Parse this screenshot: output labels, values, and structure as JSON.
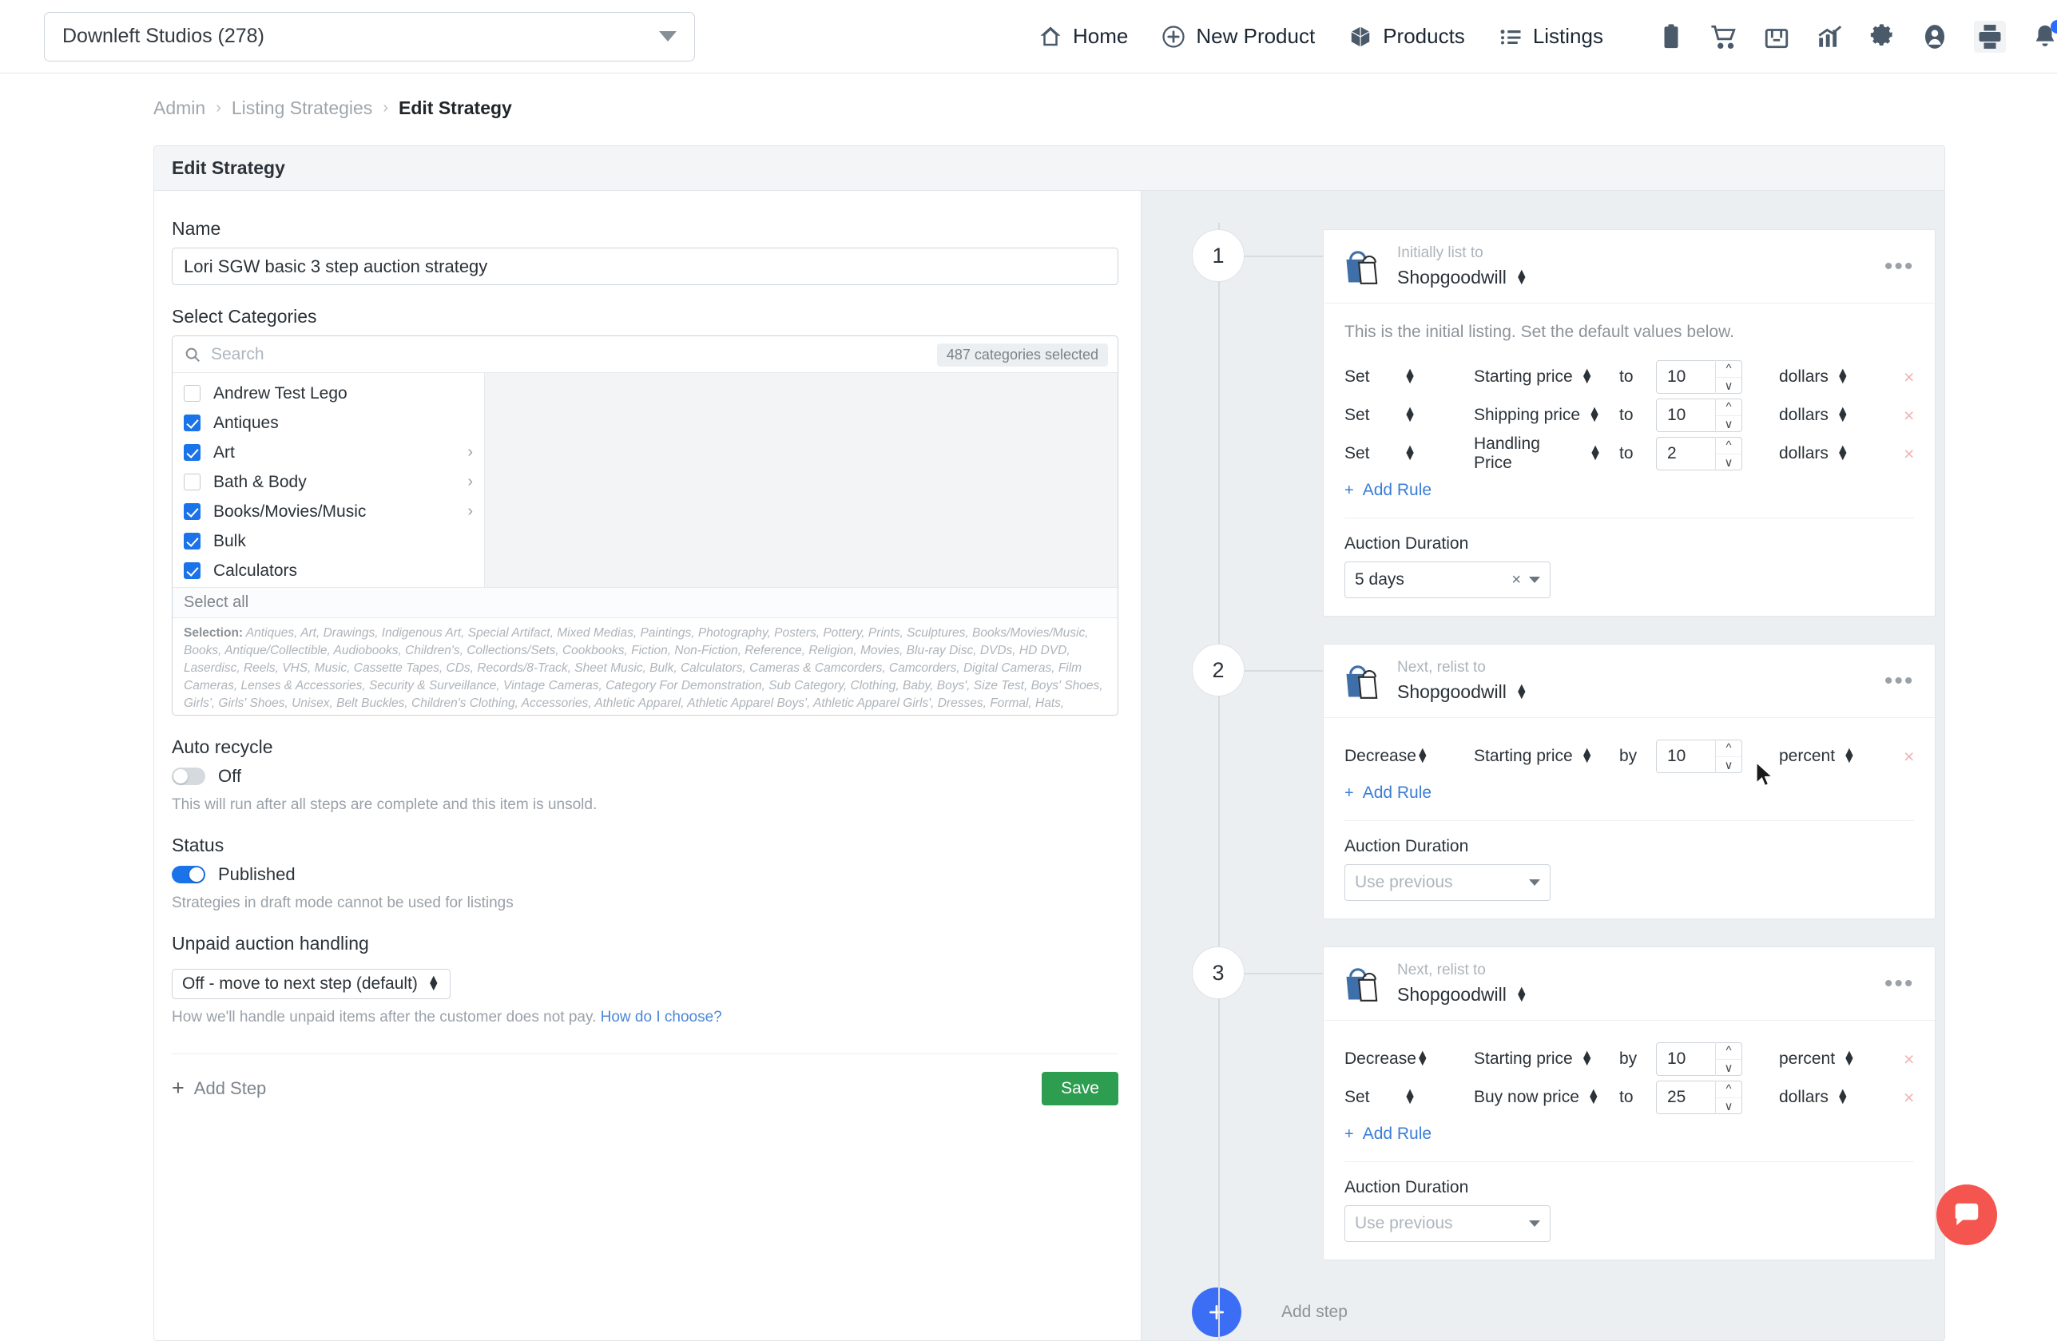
{
  "topbar": {
    "store": "Downleft Studios (278)",
    "nav": [
      {
        "label": "Home",
        "icon": "home-icon"
      },
      {
        "label": "New Product",
        "icon": "plus-circle-icon"
      },
      {
        "label": "Products",
        "icon": "box-icon"
      },
      {
        "label": "Listings",
        "icon": "list-icon"
      }
    ],
    "icons": [
      {
        "name": "clipboard-icon"
      },
      {
        "name": "cart-icon"
      },
      {
        "name": "package-icon"
      },
      {
        "name": "analytics-icon"
      },
      {
        "name": "gear-icon"
      },
      {
        "name": "user-icon"
      },
      {
        "name": "printer-icon"
      },
      {
        "name": "bell-icon"
      },
      {
        "name": "help-icon"
      }
    ],
    "notification_dot_color": "#2d6bff"
  },
  "breadcrumb": {
    "admin": "Admin",
    "listing_strategies": "Listing Strategies",
    "current": "Edit Strategy",
    "sep": "›"
  },
  "card": {
    "title": "Edit Strategy"
  },
  "form": {
    "name_label": "Name",
    "name_value": "Lori SGW basic 3 step auction strategy",
    "categories_label": "Select Categories",
    "search_placeholder": "Search",
    "categories_selected": "487 categories selected",
    "category_items": [
      {
        "label": "Andrew Test Lego",
        "checked": false,
        "expandable": false
      },
      {
        "label": "Antiques",
        "checked": true,
        "expandable": false
      },
      {
        "label": "Art",
        "checked": true,
        "expandable": true
      },
      {
        "label": "Bath & Body",
        "checked": false,
        "expandable": true
      },
      {
        "label": "Books/Movies/Music",
        "checked": true,
        "expandable": true
      },
      {
        "label": "Bulk",
        "checked": true,
        "expandable": false
      },
      {
        "label": "Calculators",
        "checked": true,
        "expandable": false
      }
    ],
    "select_all": "Select all",
    "selection_prefix": "Selection:",
    "selection_text": " Antiques, Art, Drawings, Indigenous Art, Special Artifact, Mixed Medias, Paintings, Photography, Posters, Pottery, Prints, Sculptures, Books/Movies/Music, Books, Antique/Collectible, Audiobooks, Children's, Collections/Sets, Cookbooks, Fiction, Non-Fiction, Reference, Religion, Movies, Blu-ray Disc, DVDs, HD DVD, Laserdisc, Reels, VHS, Music, Cassette Tapes, CDs, Records/8-Track, Sheet Music, Bulk, Calculators, Cameras & Camcorders, Camcorders, Digital Cameras, Film Cameras, Lenses & Accessories, Security & Surveillance, Vintage Cameras, Category For Demonstration, Sub Category, Clothing, Baby, Boys', Size Test, Boys' Shoes, Girls', Girls' Shoes, Unisex, Belt Buckles, Children's Clothing, Accessories, Athletic Apparel, Athletic Apparel Boys', Athletic Apparel Girls', Dresses, Formal, Hats, Hoodies, Hoodies Boys', Hoodies Girls', Jeans, Jeans Boys', Jeans Girls', Outerwear, Outerwear Boys', Outerwear Girls', Pants, Pants Boys', Pants Girls', Retro/Vintage,",
    "auto_recycle_label": "Auto recycle",
    "auto_recycle_state": "Off",
    "auto_recycle_on": false,
    "auto_recycle_hint": "This will run after all steps are complete and this item is unsold.",
    "status_label": "Status",
    "status_state": "Published",
    "status_on": true,
    "status_hint": "Strategies in draft mode cannot be used for listings",
    "unpaid_label": "Unpaid auction handling",
    "unpaid_value": "Off - move to next step (default)",
    "unpaid_hint": "How we'll handle unpaid items after the customer does not pay. ",
    "unpaid_hint_link": "How do I choose?",
    "add_step": "Add Step",
    "save": "Save"
  },
  "steps": [
    {
      "number": "1",
      "head_top": "Initially list to",
      "head_main": "Shopgoodwill",
      "description": "This is the initial listing. Set the default values below.",
      "rules": [
        {
          "op": "Set",
          "field": "Starting price",
          "prep": "to",
          "value": "10",
          "unit": "dollars"
        },
        {
          "op": "Set",
          "field": "Shipping price",
          "prep": "to",
          "value": "10",
          "unit": "dollars"
        },
        {
          "op": "Set",
          "field": "Handling Price",
          "prep": "to",
          "value": "2",
          "unit": "dollars"
        }
      ],
      "add_rule": "Add Rule",
      "duration_label": "Auction Duration",
      "duration_value": "5 days",
      "duration_clearable": true,
      "menu": "•••"
    },
    {
      "number": "2",
      "head_top": "Next, relist to",
      "head_main": "Shopgoodwill",
      "description": "",
      "rules": [
        {
          "op": "Decrease",
          "field": "Starting price",
          "prep": "by",
          "value": "10",
          "unit": "percent"
        }
      ],
      "add_rule": "Add Rule",
      "duration_label": "Auction Duration",
      "duration_value": "Use previous",
      "duration_clearable": false,
      "menu": "•••"
    },
    {
      "number": "3",
      "head_top": "Next, relist to",
      "head_main": "Shopgoodwill",
      "description": "",
      "rules": [
        {
          "op": "Decrease",
          "field": "Starting price",
          "prep": "by",
          "value": "10",
          "unit": "percent"
        },
        {
          "op": "Set",
          "field": "Buy now price",
          "prep": "to",
          "value": "25",
          "unit": "dollars"
        }
      ],
      "add_rule": "Add Rule",
      "duration_label": "Auction Duration",
      "duration_value": "Use previous",
      "duration_clearable": false,
      "menu": "•••"
    }
  ],
  "add_step_bottom": {
    "label": "Add step",
    "icon": "plus-icon",
    "color": "#3b6ef5"
  },
  "intercom": {
    "name": "chat-icon",
    "color": "#f4564f"
  }
}
